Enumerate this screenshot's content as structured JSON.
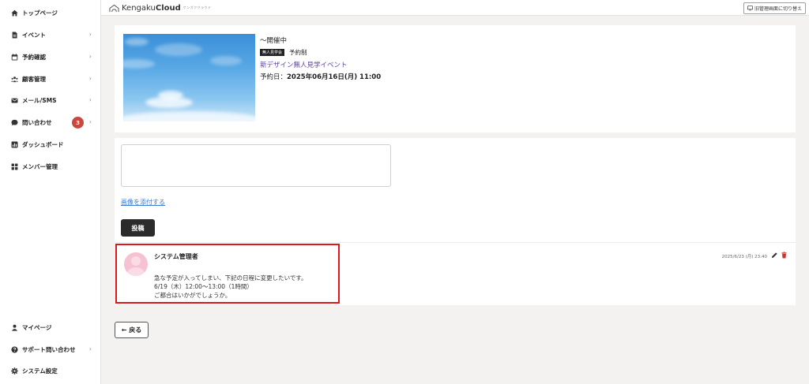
{
  "sidebar": {
    "items": [
      {
        "label": "トップページ",
        "icon": "home-icon"
      },
      {
        "label": "イベント",
        "icon": "document-icon",
        "chevron": "›"
      },
      {
        "label": "予約確認",
        "icon": "calendar-icon",
        "chevron": "›"
      },
      {
        "label": "顧客管理",
        "icon": "users-icon",
        "chevron": "›"
      },
      {
        "label": "メール/SMS",
        "icon": "mail-icon",
        "chevron": "›"
      },
      {
        "label": "問い合わせ",
        "icon": "chat-icon",
        "chevron": "›",
        "badge": "3"
      },
      {
        "label": "ダッシュボード",
        "icon": "chart-icon"
      },
      {
        "label": "メンバー管理",
        "icon": "grid-icon"
      }
    ],
    "bottom_items": [
      {
        "label": "マイページ",
        "icon": "person-icon"
      },
      {
        "label": "サポート問い合わせ",
        "icon": "question-icon",
        "chevron": "›"
      },
      {
        "label": "システム設定",
        "icon": "gear-icon"
      }
    ]
  },
  "header": {
    "logo_text_regular": "Kengaku",
    "logo_text_bold": "Cloud",
    "logo_sub": "ケンガククラウド",
    "switch_label": "旧管理画面に切り替え"
  },
  "event": {
    "status": "〜開催中",
    "tag": "無人見学会",
    "reservation_type": "予約制",
    "title": "新デザイン無人見学イベント",
    "date_label": "予約日：",
    "date_value": "2025年06月16日(月) 11:00"
  },
  "post_form": {
    "textarea_value": "",
    "attach_label": "画像を添付する",
    "submit_label": "投稿"
  },
  "comment": {
    "author": "システム管理者",
    "timestamp": "2025/6/23 (月) 23:40",
    "lines": [
      "急な予定が入ってしまい、下記の日程に変更したいです。",
      "6/19（木）12:00〜13:00（1時間）",
      "ご都合はいかがでしょうか。"
    ]
  },
  "back_label": "← 戻る",
  "colors": {
    "badge": "#c9473f",
    "link": "#3a7bd5",
    "event_title": "#5b3fa6",
    "highlight": "#e0161b",
    "delete_icon": "#c0392b"
  }
}
